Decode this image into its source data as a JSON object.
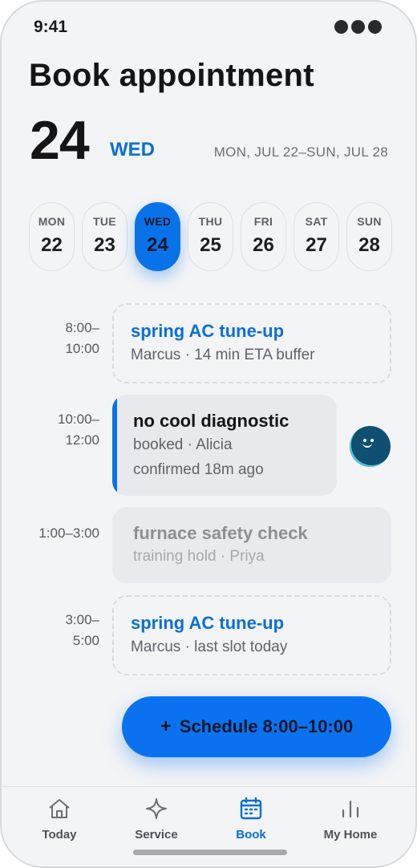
{
  "status_bar": {
    "time": "9:41"
  },
  "header": {
    "title": "Book appointment",
    "selected_day_number": "24",
    "selected_day_name": "WED",
    "week_range": "MON, JUL 22–SUN, JUL 28"
  },
  "week": [
    {
      "name": "MON",
      "date": "22",
      "selected": false
    },
    {
      "name": "TUE",
      "date": "23",
      "selected": false
    },
    {
      "name": "WED",
      "date": "24",
      "selected": true
    },
    {
      "name": "THU",
      "date": "25",
      "selected": false
    },
    {
      "name": "FRI",
      "date": "26",
      "selected": false
    },
    {
      "name": "SAT",
      "date": "27",
      "selected": false
    },
    {
      "name": "SUN",
      "date": "28",
      "selected": false
    }
  ],
  "slots": [
    {
      "time_start": "8:00–",
      "time_end": "10:00",
      "title": "spring AC tune-up",
      "detail": "Marcus · 14 min ETA buffer",
      "state": "open"
    },
    {
      "time_start": "10:00–",
      "time_end": "12:00",
      "title": "no cool diagnostic",
      "detail": "booked · Alicia",
      "detail2": "confirmed 18m ago",
      "state": "booked"
    },
    {
      "time_range": "1:00–3:00",
      "title": "furnace safety check",
      "detail": "training hold · Priya",
      "state": "hold"
    },
    {
      "time_start": "3:00–",
      "time_end": "5:00",
      "title": "spring AC tune-up",
      "detail": "Marcus · last slot today",
      "state": "open"
    }
  ],
  "fab": {
    "label": "Schedule 8:00–10:00",
    "icon": "plus-icon"
  },
  "tabs": [
    {
      "label": "Today",
      "icon": "house-icon",
      "active": false
    },
    {
      "label": "Service",
      "icon": "sparkle-icon",
      "active": false
    },
    {
      "label": "Book",
      "icon": "calendar-icon",
      "active": true
    },
    {
      "label": "My Home",
      "icon": "bar-chart-icon",
      "active": false
    }
  ],
  "colors": {
    "accent": "#0a72e8",
    "accent_text": "#0a6fd6",
    "background": "#f3f4f6"
  }
}
